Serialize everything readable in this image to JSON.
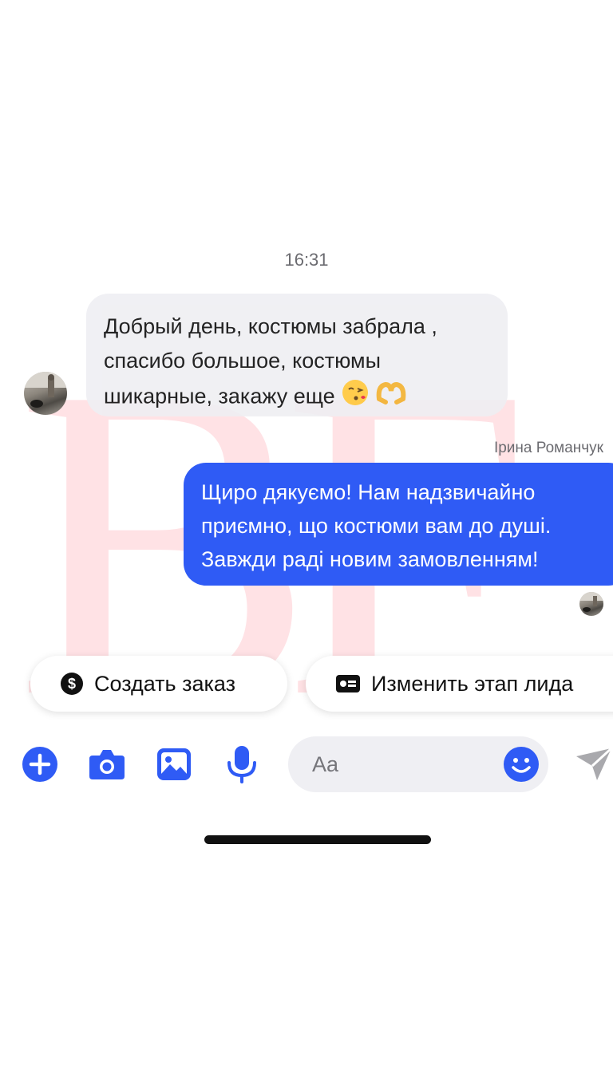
{
  "watermark": "BF",
  "chat": {
    "timestamp": "16:31",
    "incoming": {
      "lines": [
        "Добрый день, костюмы забрала ,",
        "спасибо большое, костюмы",
        "шикарные, закажу еще"
      ],
      "emojis": [
        "kissing-face-emoji",
        "heart-hands-emoji"
      ]
    },
    "outgoing": {
      "sender": "Ірина Романчук",
      "lines": [
        "Щиро дякуємо! Нам надзвичайно",
        "приємно, що костюми вам до душі.",
        "Завжди раді новим замовленням!"
      ]
    }
  },
  "quick_actions": {
    "create_order": "Создать заказ",
    "change_lead_stage": "Изменить этап лида"
  },
  "composer": {
    "placeholder": "Aa",
    "icons": [
      "plus-icon",
      "camera-icon",
      "gallery-icon",
      "microphone-icon",
      "emoji-icon",
      "send-icon"
    ]
  },
  "colors": {
    "accent": "#2f5bf5",
    "incoming_bubble": "#efeff3",
    "watermark": "#ffd9dd"
  }
}
